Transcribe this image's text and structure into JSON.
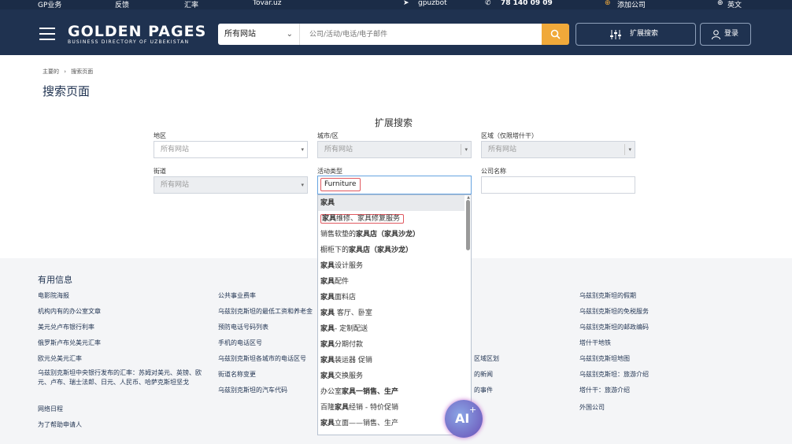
{
  "topbar": {
    "items": [
      "GP业务",
      "反馈",
      "汇率",
      "Tovar.uz",
      "gpuzbot",
      "78 140 09 09",
      "添加公司",
      "英文"
    ]
  },
  "header": {
    "logo_main": "GOLDEN PAGES",
    "logo_sub": "BUSINESS DIRECTORY OF UZBEKISTAN",
    "select_value": "所有网站",
    "search_placeholder": "公司/活动/电话/电子邮件",
    "extended_label": "扩展搜索",
    "login_label": "登录"
  },
  "breadcrumb": {
    "home": "主要的",
    "sep": "›",
    "current": "搜索页面"
  },
  "page_title": "搜索页面",
  "form": {
    "title": "扩展搜索",
    "region_label": "地区",
    "region_value": "所有网站",
    "city_label": "城市/区",
    "city_value": "所有网站",
    "district_label": "区域（仅限塔什干）",
    "district_value": "所有网站",
    "street_label": "街道",
    "street_value": "所有网站",
    "activity_label": "活动类型",
    "activity_value": "Furniture",
    "company_label": "公司名称",
    "company_value": ""
  },
  "dropdown": {
    "items": [
      {
        "bold": "家具",
        "rest": "",
        "pre": ""
      },
      {
        "bold": "家具",
        "rest": "维修、家具修复服务",
        "pre": ""
      },
      {
        "pre": "销售软垫的",
        "bold": "家具",
        "rest": "店（家具沙龙）"
      },
      {
        "pre": "橱柜下的",
        "bold": "家具",
        "rest": "店（家具沙龙）"
      },
      {
        "bold": "家具",
        "rest": "设计服务",
        "pre": ""
      },
      {
        "bold": "家具",
        "rest": "配件",
        "pre": ""
      },
      {
        "bold": "家具",
        "rest": "面料店",
        "pre": ""
      },
      {
        "bold": "家具",
        "rest": " 客厅、卧室",
        "pre": ""
      },
      {
        "bold": "家具",
        "rest": "- 定制配送",
        "pre": ""
      },
      {
        "bold": "家具",
        "rest": "分期付款",
        "pre": ""
      },
      {
        "bold": "家具",
        "rest": "装运器 促销",
        "pre": ""
      },
      {
        "bold": "家具",
        "rest": "交换服务",
        "pre": ""
      },
      {
        "pre": "办公室",
        "bold": "家具",
        "rest": "一销售、生产"
      },
      {
        "pre": "百隆",
        "bold": "家具",
        "rest": "经销 - 特价促销"
      },
      {
        "bold": "家具",
        "rest": "立面——销售、生产",
        "pre": ""
      }
    ]
  },
  "footer": {
    "heading": "有用信息",
    "col1": [
      "电影院海报",
      "机构内有的办公室文章",
      "美元兑卢布银行利率",
      "俄罗斯卢布兑美元汇率",
      "欧元兑美元汇率",
      "乌兹别克斯坦中央银行发布的汇率：苏姆对美元、英镑、欧元、卢布、瑞士法郎、日元、人民币、哈萨克斯坦坚戈",
      "网络日程",
      "为了帮助申请人"
    ],
    "col2": [
      "公共事业费率",
      "乌兹别克斯坦的最低工资和养老金",
      "预防电话号码列表",
      "手机的电话区号",
      "乌兹别克斯坦各城市的电话区号",
      "街道名称变更",
      "乌兹别克斯坦的汽车代码"
    ],
    "col3": [
      "区域区划",
      "的新闻",
      "的事件"
    ],
    "col4": [
      "乌兹别克斯坦的假期",
      "乌兹别克斯坦的免税服务",
      "乌兹别克斯坦的邮政编码",
      "塔什干地铁",
      "乌兹别克斯坦地图",
      "乌兹别克斯坦：旅游介绍",
      "塔什干：旅游介绍",
      "外国公司"
    ]
  },
  "ai_badge": "AI"
}
